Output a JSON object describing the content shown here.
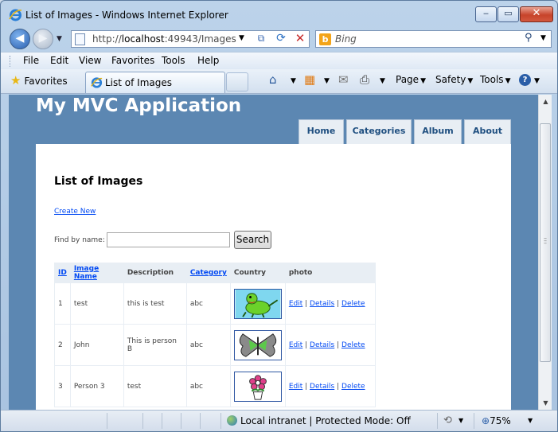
{
  "window": {
    "title": "List of Images - Windows Internet Explorer",
    "minimize_label": "‒",
    "maximize_label": "▭",
    "close_label": "✕"
  },
  "address_bar": {
    "url_prefix": "http://",
    "url_host": "localhost",
    "url_rest": ":49943/Images"
  },
  "search_box": {
    "placeholder": "Bing",
    "engine_icon": "b"
  },
  "menu": [
    "File",
    "Edit",
    "View",
    "Favorites",
    "Tools",
    "Help"
  ],
  "favorites_bar": {
    "favorites_label": "Favorites",
    "tab_label": "List of Images"
  },
  "command_bar": {
    "page_label": "Page",
    "safety_label": "Safety",
    "tools_label": "Tools"
  },
  "site": {
    "app_title": "My MVC Application",
    "nav": [
      "Home",
      "Categories",
      "Album",
      "About"
    ],
    "page_title": "List of Images",
    "create_new": "Create New",
    "find_label": "Find by name:",
    "find_value": "",
    "search_button": "Search",
    "table": {
      "headers": [
        "ID",
        "Image Name",
        "Description",
        "Category",
        "Country",
        "photo"
      ],
      "rows": [
        {
          "id": "1",
          "name": "test",
          "description": "this is test",
          "category": "abc",
          "country": "",
          "photo": "dinosaur",
          "edit": "Edit",
          "details": "Details",
          "delete": "Delete"
        },
        {
          "id": "2",
          "name": "John",
          "description": "This is person B",
          "category": "abc",
          "country": "",
          "photo": "butterfly",
          "edit": "Edit",
          "details": "Details",
          "delete": "Delete"
        },
        {
          "id": "3",
          "name": "Person 3",
          "description": "test",
          "category": "abc",
          "country": "",
          "photo": "flower",
          "edit": "Edit",
          "details": "Details",
          "delete": "Delete"
        }
      ]
    }
  },
  "status_bar": {
    "zone": "Local intranet | Protected Mode: Off",
    "zoom": "75%"
  }
}
